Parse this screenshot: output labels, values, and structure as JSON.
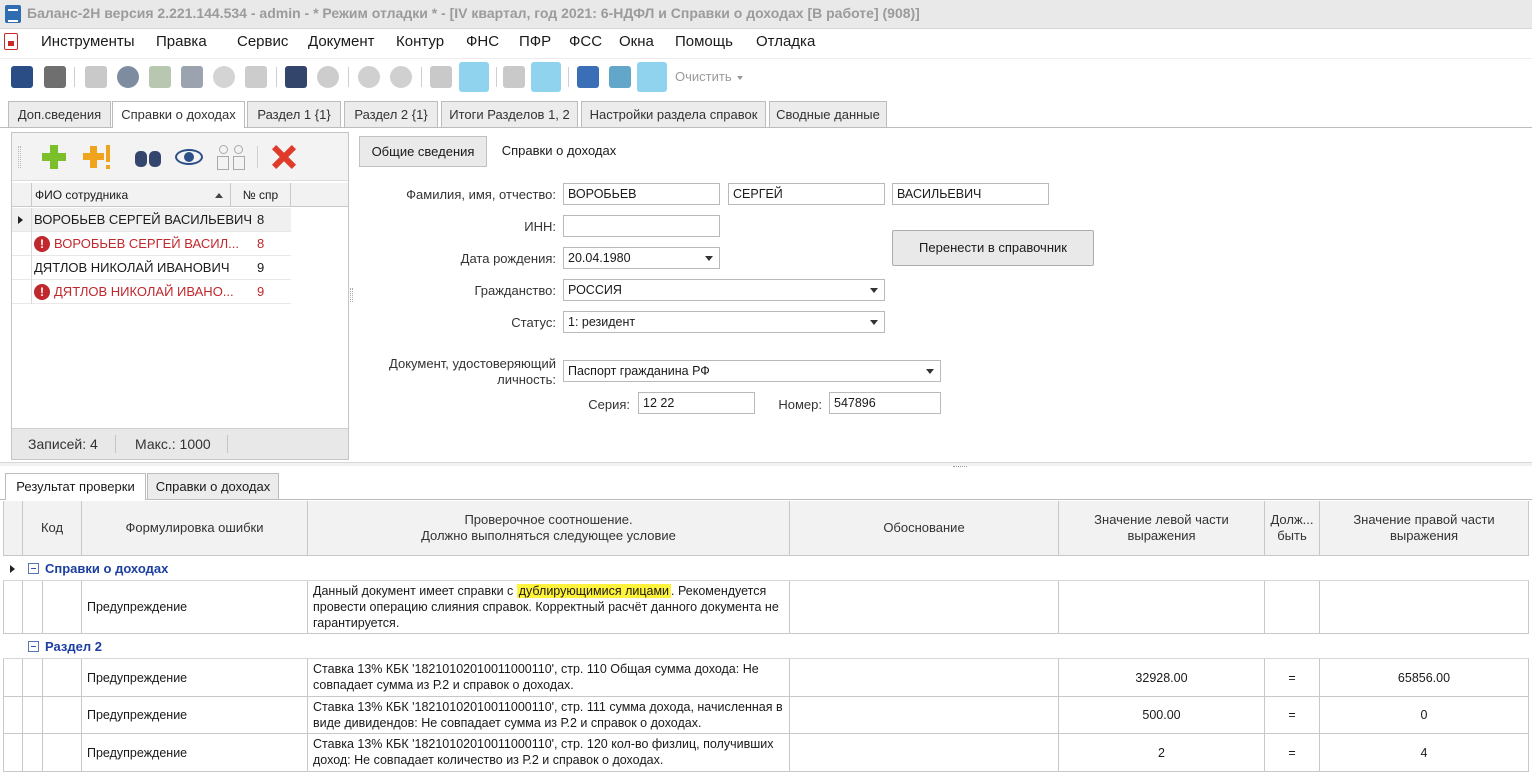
{
  "window": {
    "title": "Баланс-2Н версия 2.221.144.534 - admin  - * Режим отладки * - [IV квартал, год 2021: 6-НДФЛ и Справки о доходах [В работе] (908)]"
  },
  "menu": [
    "Инструменты",
    "Правка",
    "Сервис",
    "Документ",
    "Контур",
    "ФНС",
    "ПФР",
    "ФСС",
    "Окна",
    "Помощь",
    "Отладка"
  ],
  "toolbar": {
    "clear_label": "Очистить"
  },
  "tabs": [
    "Доп.сведения",
    "Справки о доходах",
    "Раздел 1 {1}",
    "Раздел 2 {1}",
    "Итоги Разделов 1, 2",
    "Настройки раздела справок",
    "Сводные данные"
  ],
  "employees": {
    "columns": [
      "ФИО сотрудника",
      "№ спр"
    ],
    "rows": [
      {
        "name": "ВОРОБЬЕВ СЕРГЕЙ ВАСИЛЬЕВИЧ",
        "num": "8",
        "error": false
      },
      {
        "name": "ВОРОБЬЕВ СЕРГЕЙ ВАСИЛ...",
        "num": "8",
        "error": true
      },
      {
        "name": "ДЯТЛОВ НИКОЛАЙ ИВАНОВИЧ",
        "num": "9",
        "error": false
      },
      {
        "name": "ДЯТЛОВ НИКОЛАЙ ИВАНО...",
        "num": "9",
        "error": true
      }
    ],
    "records_label": "Записей: 4",
    "max_label": "Макс.: 1000"
  },
  "subtabs": [
    "Общие сведения",
    "Справки о доходах"
  ],
  "form": {
    "fio_label": "Фамилия, имя, отчество:",
    "last_name": "ВОРОБЬЕВ",
    "first_name": "СЕРГЕЙ",
    "middle_name": "ВАСИЛЬЕВИЧ",
    "inn_label": "ИНН:",
    "inn": "",
    "birth_label": "Дата рождения:",
    "birth": "20.04.1980",
    "citizenship_label": "Гражданство:",
    "citizenship": "РОССИЯ",
    "status_label": "Статус:",
    "status": "1: резидент",
    "doc_label_1": "Документ, удостоверяющий",
    "doc_label_2": "личность:",
    "doc": "Паспорт гражданина РФ",
    "series_label": "Серия:",
    "series": "12 22",
    "number_label": "Номер:",
    "number": "547896",
    "move_button": "Перенести в справочник"
  },
  "bottom_tabs": [
    "Результат проверки",
    "Справки о доходах"
  ],
  "results": {
    "headers": {
      "code": "Код",
      "error_text": "Формулировка ошибки",
      "check_1": "Проверочное соотношение.",
      "check_2": "Должно выполняться следующее условие",
      "reason": "Обоснование",
      "left_1": "Значение левой части",
      "left_2": "выражения",
      "must_1": "Долж...",
      "must_2": "быть",
      "right_1": "Значение правой части",
      "right_2": "выражения"
    },
    "group1": "Справки о доходах",
    "row1": {
      "error": "Предупреждение",
      "text_before": "Данный документ имеет справки с ",
      "text_highlight": "дублирующимися лицами",
      "text_after": ". Рекомендуется провести операцию слияния справок. Корректный расчёт данного документа не гарантируется."
    },
    "group2": "Раздел 2",
    "rows": [
      {
        "error": "Предупреждение",
        "text": "Ставка 13% КБК '18210102010011000110', стр. 110 Общая сумма дохода: Не совпадает сумма из Р.2 и справок о доходах.",
        "left": "32928.00",
        "op": "=",
        "right": "65856.00"
      },
      {
        "error": "Предупреждение",
        "text": "Ставка 13% КБК '18210102010011000110', стр. 111 сумма дохода, начисленная в виде дивидендов: Не совпадает сумма из Р.2 и справок о доходах.",
        "left": "500.00",
        "op": "=",
        "right": "0"
      },
      {
        "error": "Предупреждение",
        "text": "Ставка 13% КБК '18210102010011000110', стр. 120 кол-во физлиц, получивших доход: Не совпадает количество из Р.2 и справок о доходах.",
        "left": "2",
        "op": "=",
        "right": "4"
      }
    ]
  },
  "colors": {
    "accent": "#1d3fa0",
    "error": "#c0282d",
    "highlight": "#fff23a"
  }
}
